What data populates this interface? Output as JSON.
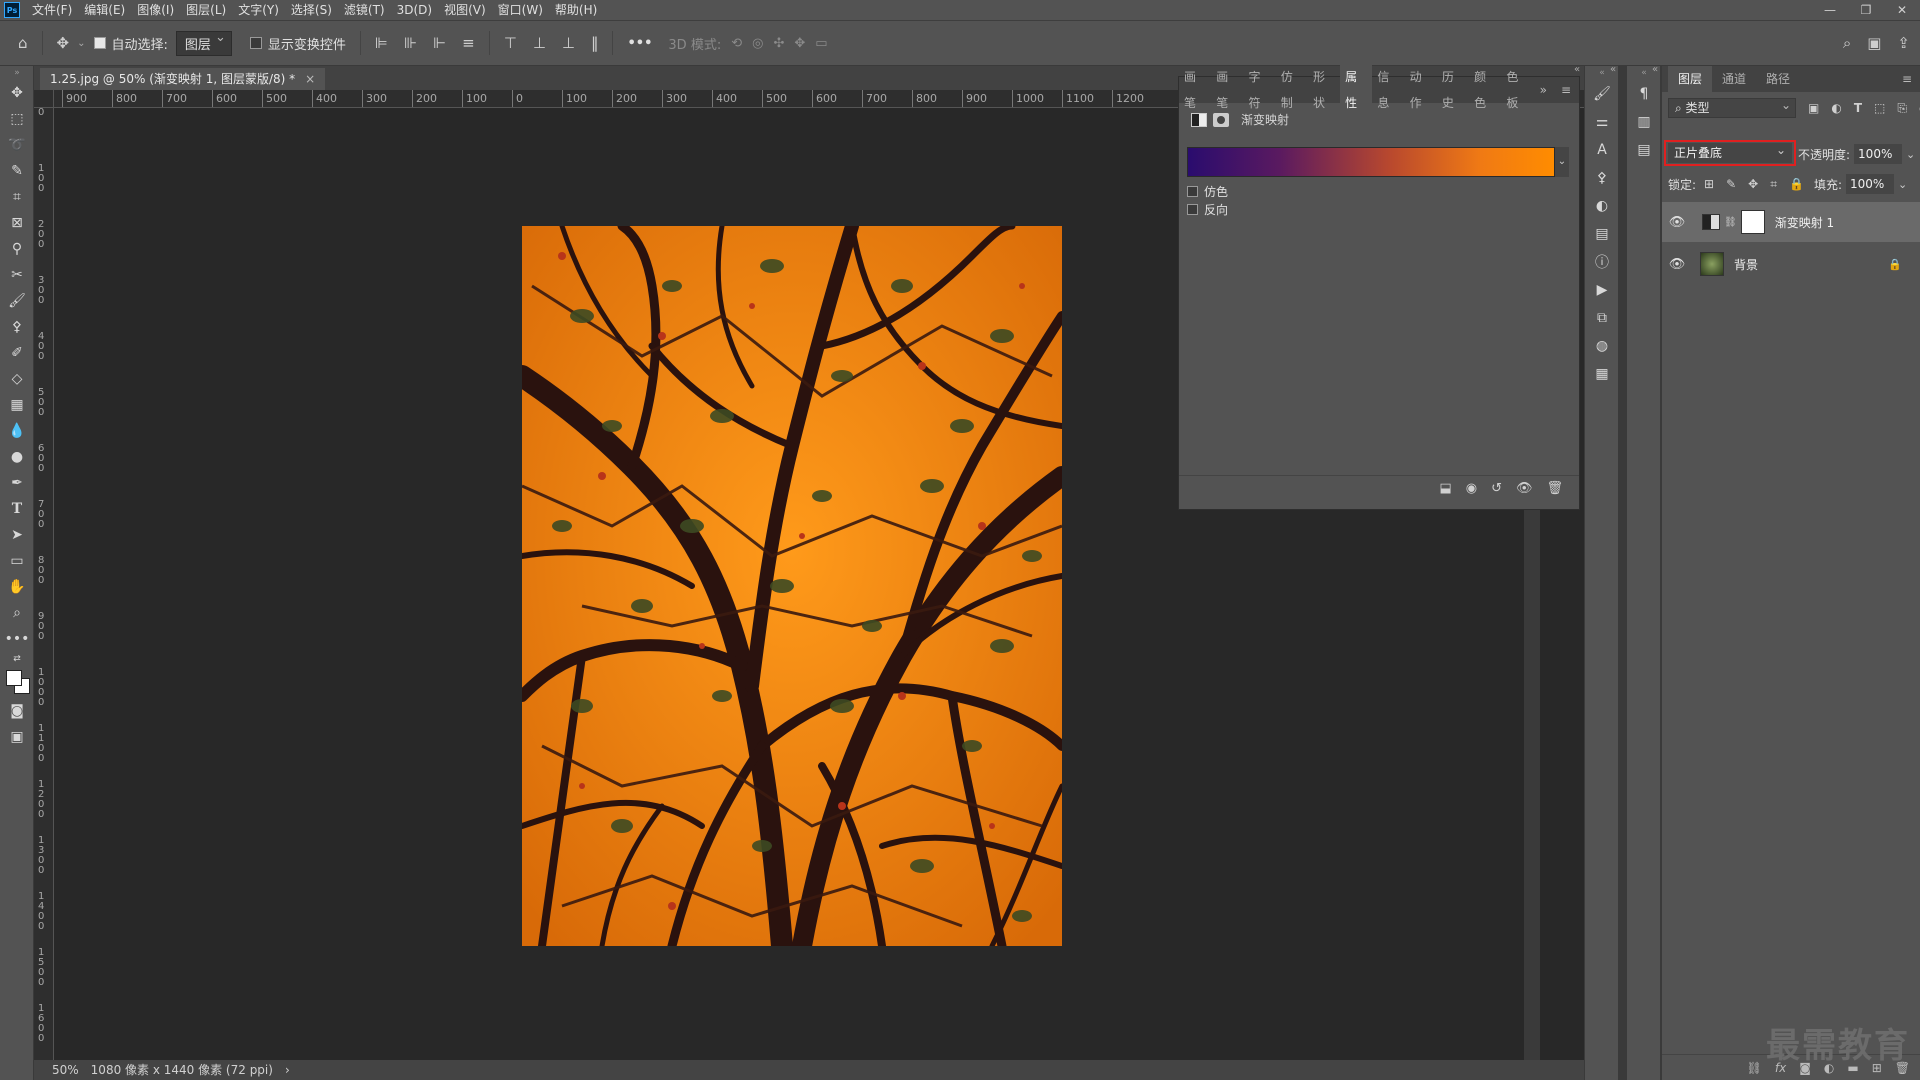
{
  "menu": {
    "logo": "Ps",
    "items": [
      "文件(F)",
      "编辑(E)",
      "图像(I)",
      "图层(L)",
      "文字(Y)",
      "选择(S)",
      "滤镜(T)",
      "3D(D)",
      "视图(V)",
      "窗口(W)",
      "帮助(H)"
    ],
    "window_controls": [
      "—",
      "❐",
      "✕"
    ]
  },
  "options": {
    "auto_select_label": "自动选择:",
    "auto_select_checked": true,
    "layer_select": "图层",
    "show_transform_label": "显示变换控件",
    "mode_3d_label": "3D 模式:",
    "more_label": "•••"
  },
  "document": {
    "tab_title": "1.25.jpg @ 50% (渐变映射 1, 图层蒙版/8) *",
    "close": "×"
  },
  "rulers": {
    "h_labels": [
      "900",
      "800",
      "700",
      "600",
      "500",
      "400",
      "300",
      "200",
      "100",
      "0",
      "100",
      "200",
      "300",
      "400",
      "500",
      "600",
      "700",
      "800",
      "900",
      "1000",
      "1100",
      "1200"
    ],
    "v_labels": [
      "0",
      "100",
      "200",
      "300",
      "400",
      "500",
      "600",
      "700",
      "800",
      "900",
      "1000",
      "1100",
      "1200",
      "1300",
      "1400",
      "1500",
      "1600"
    ]
  },
  "status": {
    "zoom": "50%",
    "doc_info": "1080 像素 x 1440 像素 (72 ppi)",
    "arrow": "›"
  },
  "properties": {
    "tabs": [
      "画笔",
      "画笔",
      "字符",
      "仿制",
      "形状",
      "属性",
      "信息",
      "动作",
      "历史",
      "颜色",
      "色板"
    ],
    "active_tab": "属性",
    "title": "渐变映射",
    "dither_label": "仿色",
    "dither_checked": false,
    "reverse_label": "反向",
    "reverse_checked": false,
    "gradient_colors": [
      "#2a0c6e",
      "#5a1a60",
      "#b8482e",
      "#f07a14",
      "#ff8c00"
    ],
    "more": "»"
  },
  "layers_panel": {
    "tabs": [
      "图层",
      "通道",
      "路径"
    ],
    "active_tab": "图层",
    "filter_kind": "类型",
    "blend_mode": "正片叠底",
    "opacity_label": "不透明度:",
    "opacity_value": "100%",
    "lock_label": "锁定:",
    "fill_label": "填充:",
    "fill_value": "100%",
    "layers": [
      {
        "name": "渐变映射 1",
        "visible": true,
        "selected": true,
        "type": "adjustment"
      },
      {
        "name": "背景",
        "visible": true,
        "selected": false,
        "locked": true,
        "type": "image"
      }
    ],
    "footer_icons": [
      "link-icon",
      "fx-icon",
      "mask-icon",
      "adjustment-icon",
      "folder-icon",
      "new-layer-icon",
      "trash-icon"
    ]
  },
  "watermark": "最需教育",
  "colors": {
    "photo_highlight": "#f2840c",
    "photo_shadow": "#2a120e",
    "selection_outline": "#e02020"
  }
}
